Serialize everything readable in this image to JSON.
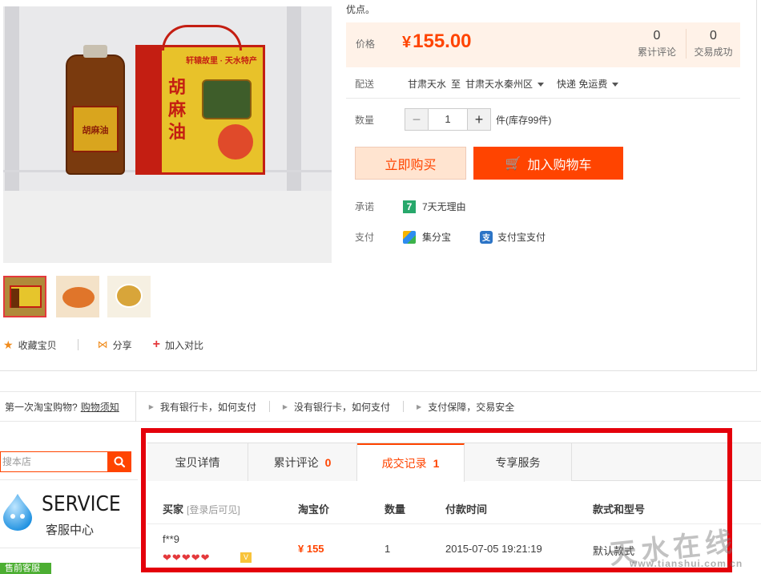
{
  "product": {
    "box_title": "胡麻油",
    "box_subtitle": "轩辕故里 · 天水特产",
    "bottle_label": "胡麻油"
  },
  "summary": {
    "top_text": "优点。"
  },
  "price": {
    "label": "价格",
    "currency": "¥",
    "value": "155.00",
    "reviews_count": "0",
    "reviews_label": "累计评论",
    "sales_count": "0",
    "sales_label": "交易成功"
  },
  "shipping": {
    "label": "配送",
    "from": "甘肃天水",
    "to_word": "至",
    "to": "甘肃天水秦州区",
    "method": "快递 免运费"
  },
  "quantity": {
    "label": "数量",
    "minus": "−",
    "value": "1",
    "plus": "+",
    "stock": "件(库存99件)"
  },
  "actions": {
    "buy_now": "立即购买",
    "add_cart": "加入购物车"
  },
  "promise": {
    "label": "承诺",
    "badge": "7",
    "text": "7天无理由"
  },
  "payment": {
    "label": "支付",
    "jfb": "集分宝",
    "alipay": "支付宝支付"
  },
  "gallery_actions": {
    "favorite": "收藏宝贝",
    "share": "分享",
    "compare": "加入对比"
  },
  "notice": {
    "first_q": "第一次淘宝购物?",
    "first_link": "购物须知",
    "item1": "我有银行卡，如何支付",
    "item2": "没有银行卡，如何支付",
    "item3": "支付保障，交易安全"
  },
  "sidebar": {
    "search_placeholder": "搜本店",
    "service_title": "SERVICE",
    "service_sub": "客服中心",
    "tag": "售前客服"
  },
  "tabs": [
    {
      "label": "宝贝详情",
      "count": ""
    },
    {
      "label": "累计评论",
      "count": "0"
    },
    {
      "label": "成交记录",
      "count": "1"
    },
    {
      "label": "专享服务",
      "count": ""
    }
  ],
  "records": {
    "headers": {
      "buyer": "买家",
      "buyer_hint": "[登录后可见]",
      "price": "淘宝价",
      "qty": "数量",
      "time": "付款时间",
      "variant": "款式和型号"
    },
    "rows": [
      {
        "buyer": "f**9",
        "price": "¥ 155",
        "qty": "1",
        "time": "2015-07-05 19:21:19",
        "variant": "默认款式"
      }
    ]
  },
  "watermark": {
    "text": "天水在线",
    "url": "www.tianshui.com.cn"
  },
  "colors": {
    "accent": "#ff4400",
    "highlight": "#e4000b",
    "price_bg": "#fff2e8"
  }
}
